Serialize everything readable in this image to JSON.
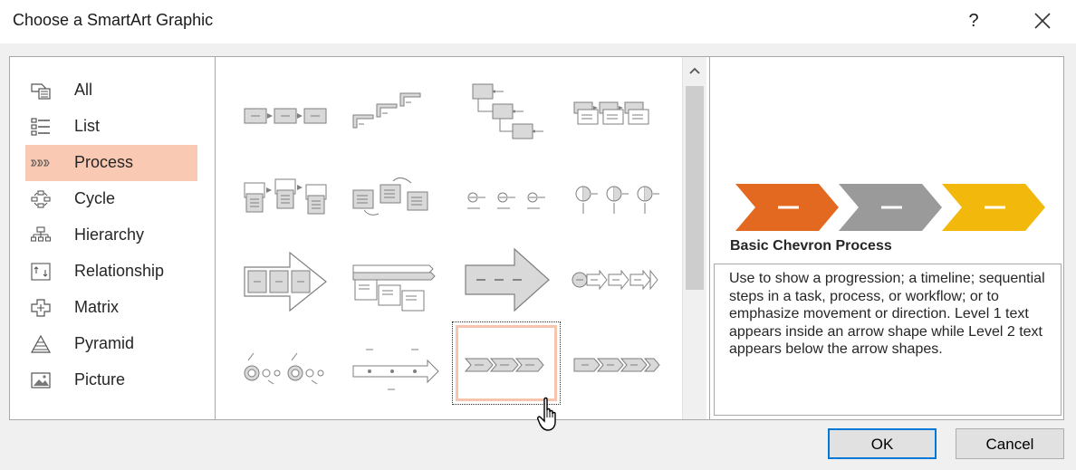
{
  "dialog": {
    "title": "Choose a SmartArt Graphic",
    "help_label": "?"
  },
  "categories": [
    {
      "label": "All",
      "icon": "all-icon",
      "selected": false
    },
    {
      "label": "List",
      "icon": "list-icon",
      "selected": false
    },
    {
      "label": "Process",
      "icon": "process-icon",
      "selected": true
    },
    {
      "label": "Cycle",
      "icon": "cycle-icon",
      "selected": false
    },
    {
      "label": "Hierarchy",
      "icon": "hierarchy-icon",
      "selected": false
    },
    {
      "label": "Relationship",
      "icon": "relationship-icon",
      "selected": false
    },
    {
      "label": "Matrix",
      "icon": "matrix-icon",
      "selected": false
    },
    {
      "label": "Pyramid",
      "icon": "pyramid-icon",
      "selected": false
    },
    {
      "label": "Picture",
      "icon": "picture-icon",
      "selected": false
    }
  ],
  "gallery": {
    "selected_layout": "basic-chevron-process"
  },
  "preview": {
    "title": "Basic Chevron Process",
    "description": "Use to show a progression; a timeline; sequential steps in a task, process, or workflow; or to emphasize movement or direction. Level 1 text appears inside an arrow shape while Level 2 text appears below the arrow shapes.",
    "colors": {
      "chevron_1": "#e2691f",
      "chevron_2": "#9a9a9a",
      "chevron_3": "#f2b90c"
    }
  },
  "buttons": {
    "ok": "OK",
    "cancel": "Cancel"
  },
  "accent": {
    "selection": "#f9c9b3",
    "focus": "#0078d7"
  }
}
